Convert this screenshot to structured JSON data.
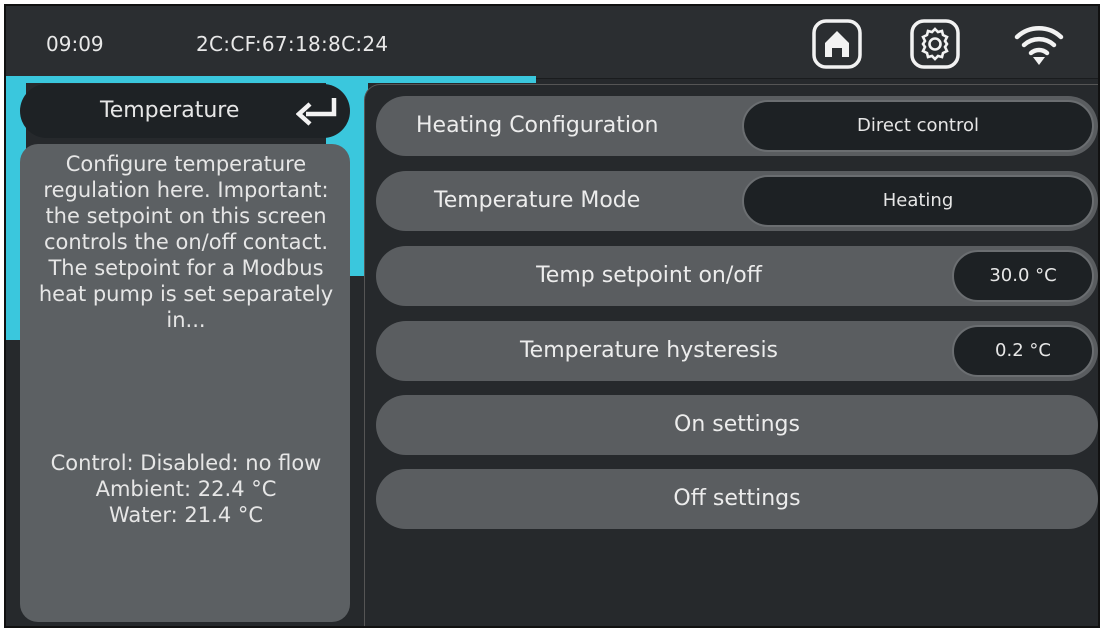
{
  "header": {
    "time": "09:09",
    "mac": "2C:CF:67:18:8C:24",
    "icons": [
      "home-icon",
      "gear-icon",
      "wifi-icon"
    ]
  },
  "sidebar": {
    "title": "Temperature",
    "back_icon": "return-arrow-icon",
    "description": "Configure temperature regulation here. Important: the setpoint on this screen controls the on/off contact. The setpoint for a Modbus heat pump is set separately in...",
    "status": {
      "control": "Control: Disabled: no flow",
      "ambient": "Ambient: 22.4 °C",
      "water": "Water: 21.4 °C"
    }
  },
  "settings": {
    "heating_config": {
      "label": "Heating Configuration",
      "value": "Direct control"
    },
    "temp_mode": {
      "label": "Temperature Mode",
      "value": "Heating"
    },
    "setpoint": {
      "label": "Temp setpoint on/off",
      "value": "30.0 °C"
    },
    "hysteresis": {
      "label": "Temperature hysteresis",
      "value": "0.2 °C"
    },
    "on_settings": "On settings",
    "off_settings": "Off settings"
  },
  "colors": {
    "accent": "#3ac7dd",
    "background": "#26292c",
    "panel": "#5c6063",
    "pill": "#1d2124"
  }
}
